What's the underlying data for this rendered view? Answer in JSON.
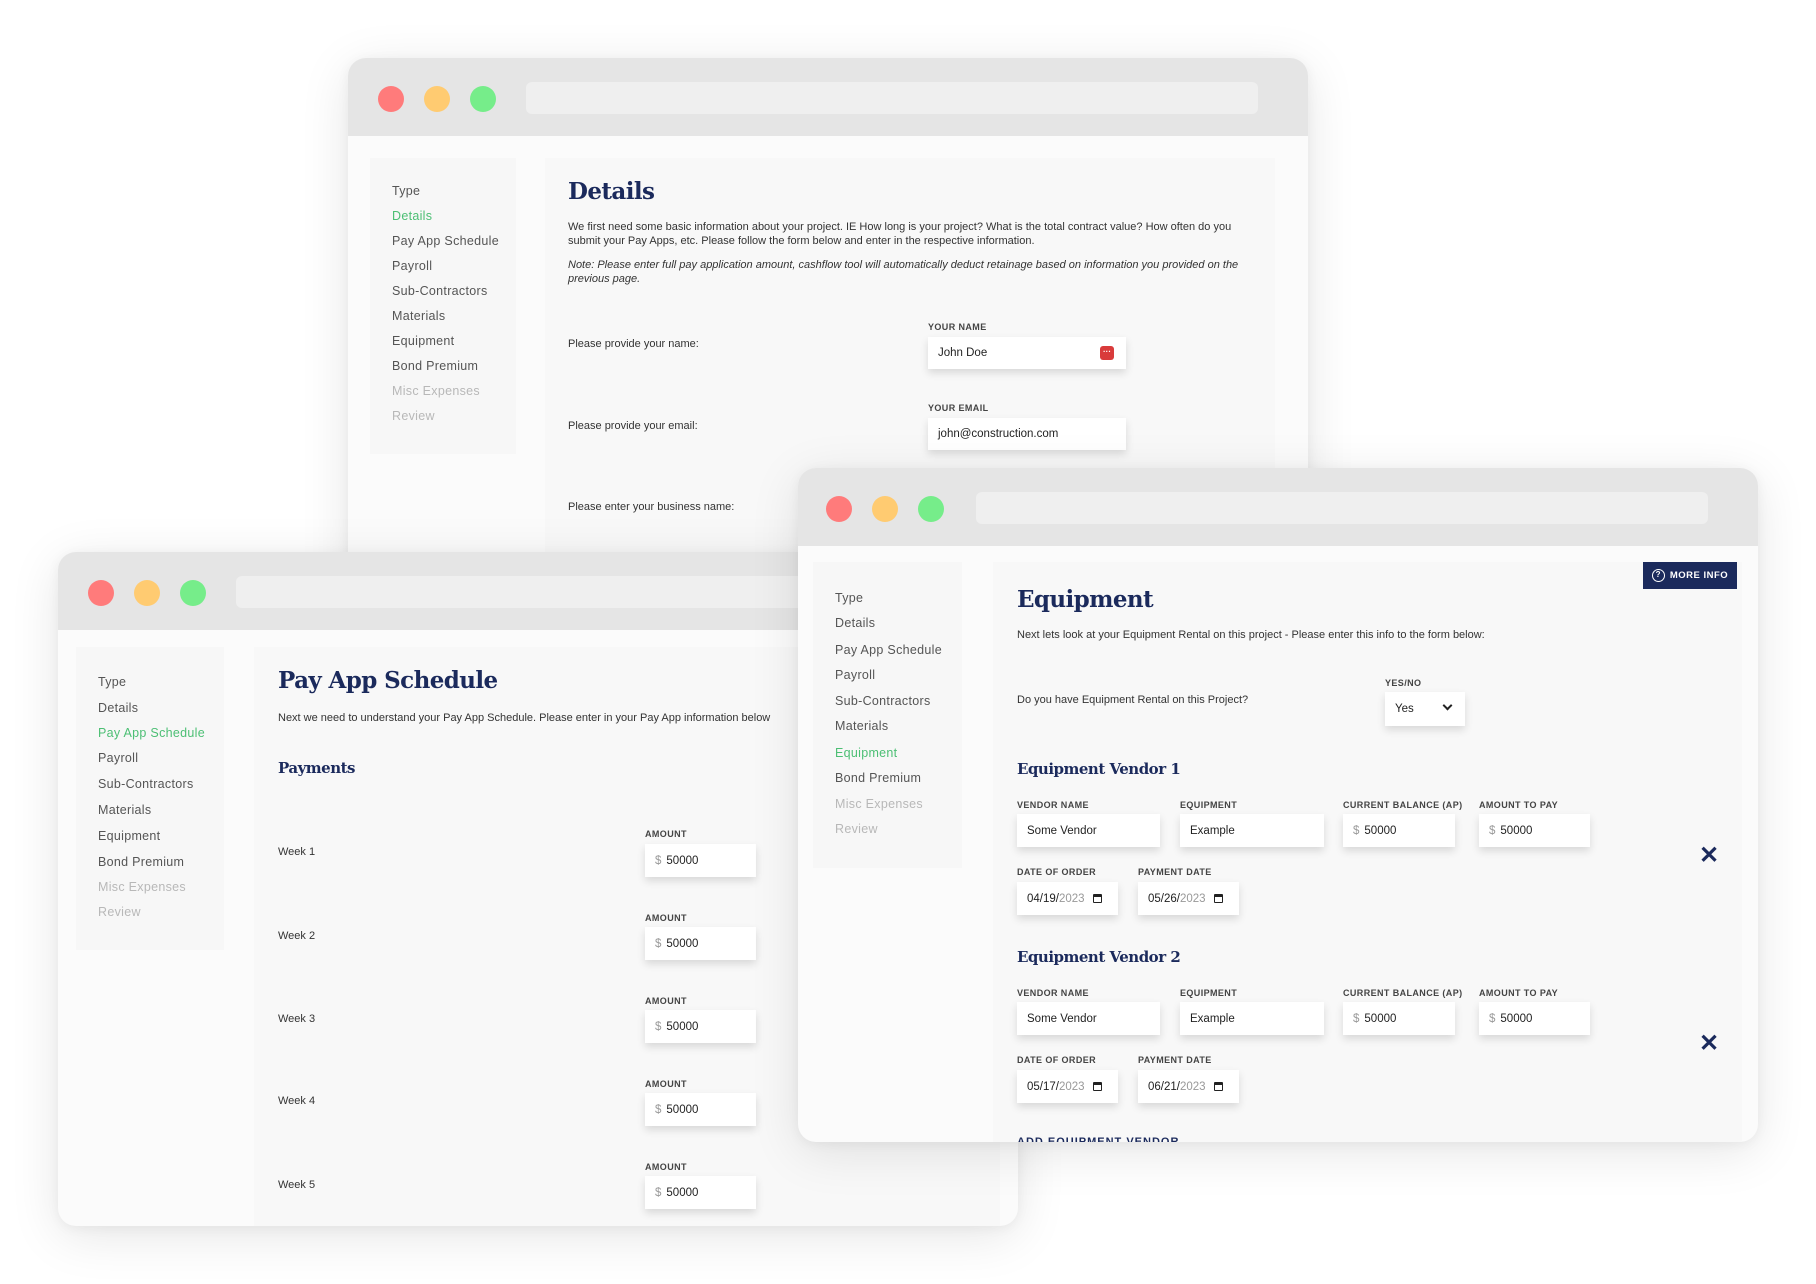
{
  "sidebar_items": [
    "Type",
    "Details",
    "Pay App Schedule",
    "Payroll",
    "Sub-Contractors",
    "Materials",
    "Equipment",
    "Bond Premium",
    "Misc Expenses",
    "Review"
  ],
  "details_window": {
    "active_item": "Details",
    "title": "Details",
    "intro": "We first need some basic information about your project. IE How long is your project? What is the total contract value? How often do you submit your Pay Apps, etc. Please follow the form below and enter in the respective information.",
    "note": "Note: Please enter full pay application amount, cashflow tool will automatically deduct retainage based on information you provided on the previous page.",
    "fields": [
      {
        "question": "Please provide your name:",
        "label": "YOUR NAME",
        "value": "John Doe"
      },
      {
        "question": "Please provide your email:",
        "label": "YOUR EMAIL",
        "value": "john@construction.com"
      },
      {
        "question": "Please enter your business name:"
      }
    ]
  },
  "payapp_window": {
    "active_item": "Pay App Schedule",
    "title": "Pay App Schedule",
    "intro": "Next we need to understand your Pay App Schedule. Please enter in your Pay App information below",
    "section": "Payments",
    "amount_label": "AMOUNT",
    "currency": "$",
    "weeks": [
      {
        "label": "Week 1",
        "amount": "50000"
      },
      {
        "label": "Week 2",
        "amount": "50000"
      },
      {
        "label": "Week 3",
        "amount": "50000"
      },
      {
        "label": "Week 4",
        "amount": "50000"
      },
      {
        "label": "Week 5",
        "amount": "50000"
      }
    ]
  },
  "equipment_window": {
    "active_item": "Equipment",
    "title": "Equipment",
    "more_info": "MORE INFO",
    "intro": "Next lets look at your Equipment Rental on this project - Please enter this info to the form below:",
    "rental_question": "Do you have Equipment Rental on this Project?",
    "yesno_label": "YES/NO",
    "yesno_value": "Yes",
    "labels": {
      "vendor_name": "VENDOR NAME",
      "equipment": "EQUIPMENT",
      "current_balance": "CURRENT BALANCE (AP)",
      "amount_to_pay": "AMOUNT TO PAY",
      "date_of_order": "DATE OF ORDER",
      "payment_date": "PAYMENT DATE"
    },
    "currency": "$",
    "vendors": [
      {
        "heading": "Equipment Vendor 1",
        "vendor_name": "Some Vendor",
        "equipment": "Example",
        "current_balance": "50000",
        "amount_to_pay": "50000",
        "order_md": "04/19/",
        "order_y": "2023",
        "pay_md": "05/26/",
        "pay_y": "2023"
      },
      {
        "heading": "Equipment Vendor 2",
        "vendor_name": "Some Vendor",
        "equipment": "Example",
        "current_balance": "50000",
        "amount_to_pay": "50000",
        "order_md": "05/17/",
        "order_y": "2023",
        "pay_md": "06/21/",
        "pay_y": "2023"
      }
    ],
    "add_vendor": "ADD EQUIPMENT VENDOR"
  }
}
